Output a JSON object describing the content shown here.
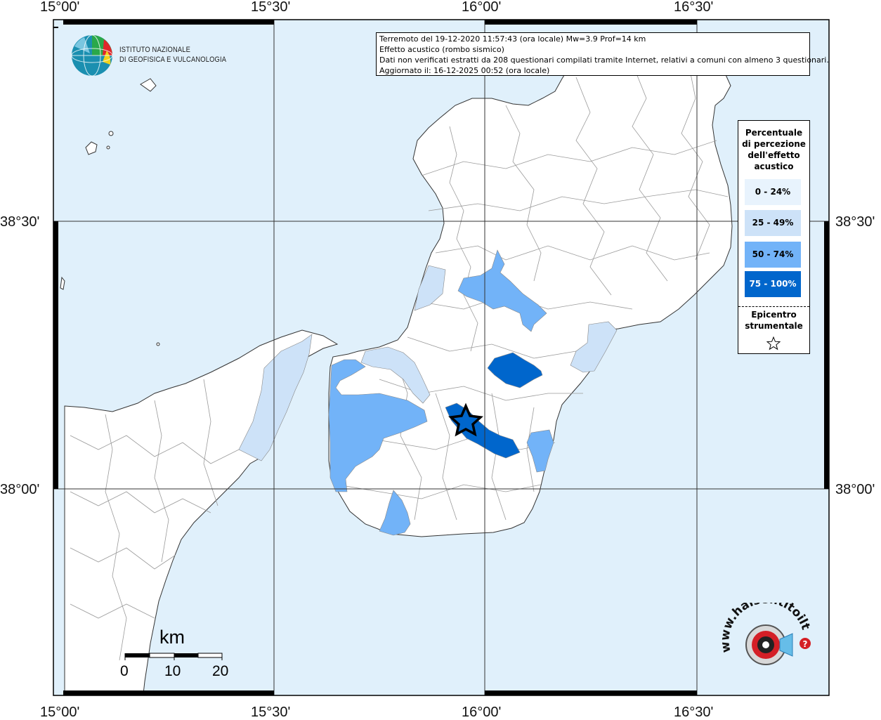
{
  "map": {
    "lon_labels": [
      "15°00'",
      "15°30'",
      "16°00'",
      "16°30'"
    ],
    "lat_labels": [
      "38°30'",
      "38°00'"
    ],
    "colors": {
      "sea": "#e0f0fb",
      "land": "#ffffff",
      "class_0_24": "#e8f3fd",
      "class_25_49": "#cde2f8",
      "class_50_74": "#72b3f8",
      "class_75_100": "#0066cc"
    }
  },
  "info": {
    "line1": "Terremoto del 19-12-2020 11:57:43 (ora locale) Mw=3.9 Prof=14 km",
    "line2": "Effetto acustico (rombo sismico)",
    "line3": "Dati non verificati estratti da 208 questionari compilati tramite Internet, relativi a comuni con almeno 3 questionari.",
    "line4": "Aggiornato il: 16-12-2025 00:52 (ora locale)"
  },
  "legend": {
    "title_lines": [
      "Percentuale",
      "di percezione",
      "dell'effetto",
      "acustico"
    ],
    "classes": [
      {
        "label": "0 - 24%",
        "color": "#e8f3fd",
        "text_color": "#000000"
      },
      {
        "label": "25 - 49%",
        "color": "#cde2f8",
        "text_color": "#000000"
      },
      {
        "label": "50 - 74%",
        "color": "#72b3f8",
        "text_color": "#000000"
      },
      {
        "label": "75 - 100%",
        "color": "#0066cc",
        "text_color": "#ffffff"
      }
    ],
    "epicentre_lines": [
      "Epicentro",
      "strumentale"
    ],
    "epicentre_icon": "star-icon"
  },
  "ingv": {
    "line1": "ISTITUTO NAZIONALE",
    "line2": "DI GEOFISICA E VULCANOLOGIA"
  },
  "scale": {
    "unit": "km",
    "ticks": [
      "0",
      "10",
      "20"
    ]
  },
  "hst": {
    "text": "www.haisentitoilterremoto.it"
  }
}
